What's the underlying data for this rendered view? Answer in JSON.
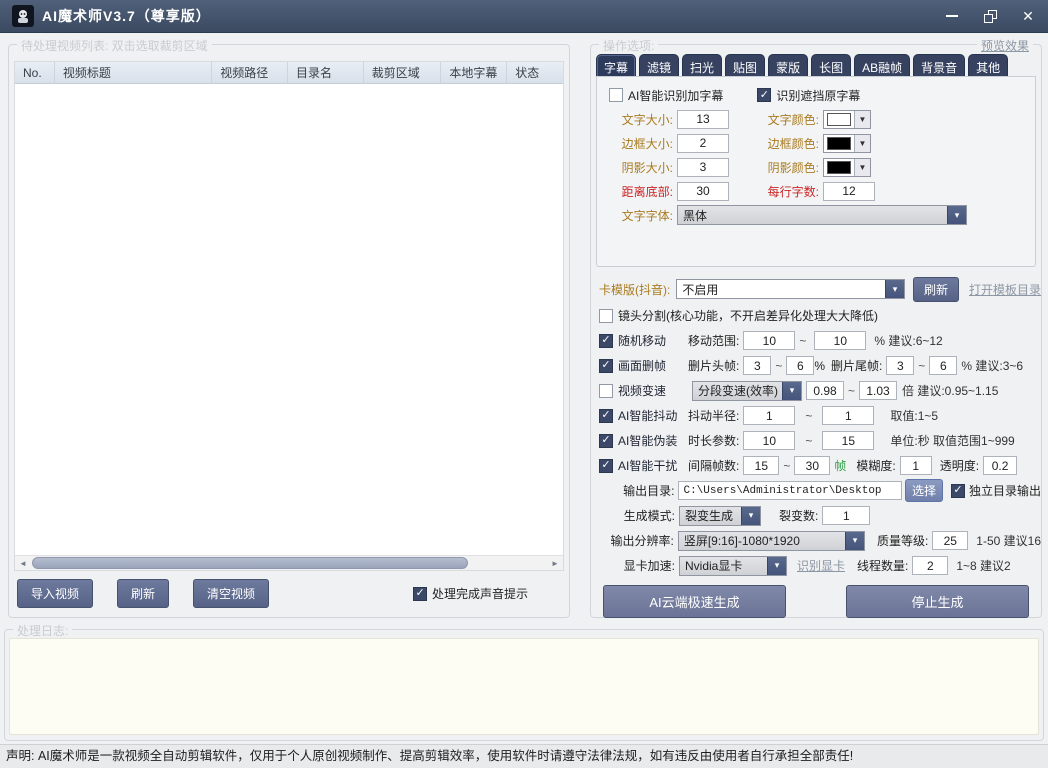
{
  "colors": {
    "titlebar": "#42526b",
    "tab_navy": "#36425f",
    "button_slate": "#5f6d96",
    "checkbox_navy": "#3c4868",
    "label_orange": "#a97b1f",
    "label_red": "#cc2424",
    "unit_green": "#2f9e44"
  },
  "tb": {
    "title": "AI魔术师V3.7（尊享版）"
  },
  "lp": {
    "group_title": "待处理视频列表: 双击选取裁剪区域",
    "cols": [
      "No.",
      "视频标题",
      "视频路径",
      "目录名",
      "裁剪区域",
      "本地字幕",
      "状态"
    ],
    "import": "导入视频",
    "refresh": "刷新",
    "clear": "清空视频",
    "sound": "处理完成声音提示"
  },
  "rp": {
    "group_title": "操作选项:",
    "preview_link": "预览效果",
    "tabs": [
      "字幕",
      "滤镜",
      "扫光",
      "贴图",
      "蒙版",
      "长图",
      "AB融帧",
      "背景音",
      "其他"
    ],
    "sym": {
      "tilde": "~"
    },
    "sub": {
      "ai_add": "AI智能识别加字幕",
      "mask_orig": "识别遮挡原字幕",
      "font_size_l": "文字大小:",
      "font_size": "13",
      "font_color_l": "文字颜色:",
      "border_size_l": "边框大小:",
      "border_size": "2",
      "border_color_l": "边框颜色:",
      "shadow_size_l": "阴影大小:",
      "shadow_size": "3",
      "shadow_color_l": "阴影颜色:",
      "bottom_l": "距离底部:",
      "bottom": "30",
      "perline_l": "每行字数:",
      "perline": "12",
      "font_l": "文字字体:",
      "font_v": "黑体"
    },
    "tpl": {
      "l": "卡模版(抖音):",
      "v": "不启用",
      "refresh": "刷新",
      "open": "打开模板目录"
    },
    "rows": {
      "split_l": "镜头分割(核心功能，不开启差异化处理大大降低)",
      "move_l": "随机移动",
      "move_range_l": "移动范围:",
      "move_min": "10",
      "move_max": "10",
      "move_hint": "%  建议:6~12",
      "delf_l": "画面删帧",
      "delf_head_l": "删片头帧:",
      "delf_head_min": "3",
      "delf_head_max": "6",
      "delf_pct": "%",
      "delf_tail_l": "删片尾帧:",
      "delf_tail_min": "3",
      "delf_tail_max": "6",
      "delf_hint": "% 建议:3~6",
      "speed_l": "视频变速",
      "speed_mode": "分段变速(效率)",
      "speed_min": "0.98",
      "speed_max": "1.03",
      "speed_hint": "倍 建议:0.95~1.15",
      "shake_l": "AI智能抖动",
      "shake_pl": "抖动半径:",
      "shake_min": "1",
      "shake_max": "1",
      "shake_hint": "取值:1~5",
      "disg_l": "AI智能伪装",
      "disg_pl": "时长参数:",
      "disg_min": "10",
      "disg_max": "15",
      "disg_hint": "单位:秒 取值范围1~999",
      "intf_l": "AI智能干扰",
      "intf_pl": "间隔帧数:",
      "intf_min": "15",
      "intf_max": "30",
      "intf_unit": "帧",
      "blur_l": "模糊度:",
      "blur": "1",
      "opa_l": "透明度:",
      "opa": "0.2"
    },
    "out": {
      "dir_l": "输出目录:",
      "dir": "C:\\Users\\Administrator\\Desktop",
      "choose": "选择",
      "indep": "独立目录输出",
      "mode_l": "生成模式:",
      "mode": "裂变生成",
      "fiss_l": "裂变数:",
      "fiss": "1",
      "res_l": "输出分辨率:",
      "res": "竖屏[9:16]-1080*1920",
      "qual_l": "质量等级:",
      "qual": "25",
      "qual_hint": "1-50 建议16",
      "gpu_l": "显卡加速:",
      "gpu": "Nvidia显卡",
      "gpu_link": "识别显卡",
      "thr_l": "线程数量:",
      "thr": "2",
      "thr_hint": "1~8 建议2"
    },
    "gen": {
      "cloud": "AI云端极速生成",
      "stop": "停止生成"
    }
  },
  "log": {
    "title": "处理日志:"
  },
  "sb": {
    "text": "声明: AI魔术师是一款视频全自动剪辑软件，仅用于个人原创视频制作、提高剪辑效率，使用软件时请遵守法律法规，如有违反由使用者自行承担全部责任!"
  }
}
